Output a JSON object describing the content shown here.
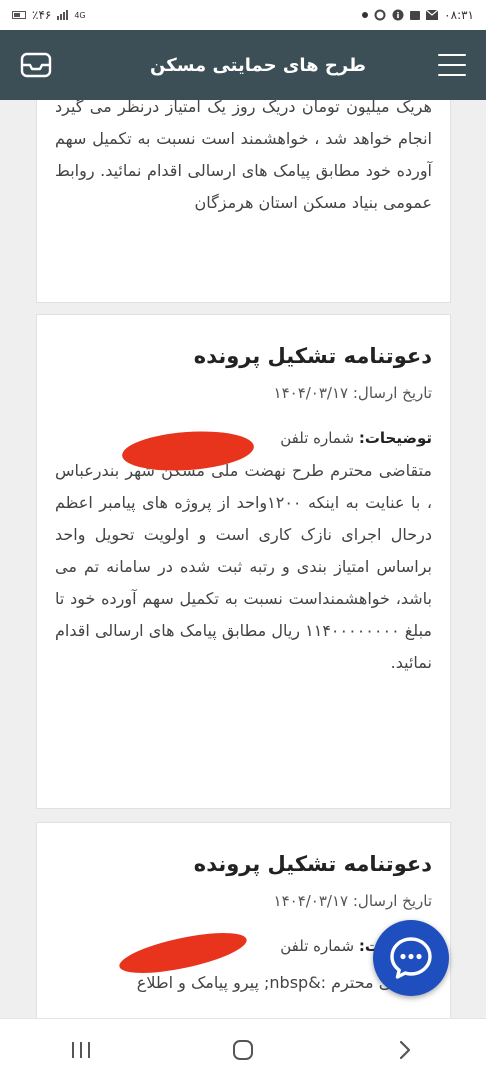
{
  "status_bar": {
    "time": "۰۸:۳۱",
    "battery": "٪۴۶",
    "network": "4G"
  },
  "app_bar": {
    "title": "طرح های حمایتی مسکن",
    "menu_icon": "hamburger-menu-icon",
    "inbox_icon": "inbox-tray-icon"
  },
  "cards": [
    {
      "partial_text": "هریک میلیون تومان دریک روز یک امتیاز درنظر می گیرد انجام خواهد شد ، خواهشمند است نسبت به تکمیل سهم آورده خود مطابق پیامک های ارسالی اقدام نمائید. روابط عمومی بنیاد مسکن استان هرمزگان"
    },
    {
      "title": "دعوتنامه تشکیل پرونده",
      "date_label": "تاریخ ارسال:",
      "date": "۱۴۰۴/۰۳/۱۷",
      "desc_label": "توضیحات:",
      "desc_prefix": "شماره تلفن",
      "body": "متقاضی محترم طرح نهضت ملی مسکن شهر بندرعباس ، با عنایت به اینکه ۱۲۰۰واحد از پروژه های پیامبر اعظم درحال اجرای نازک کاری است و اولویت تحویل واحد براساس امتیاز بندی و رتبه ثبت شده در سامانه تم می باشد، خواهشمنداست نسبت به تکمیل سهم آورده خود تا مبلغ ۱۱۴۰۰۰۰۰۰۰۰ ریال مطابق پیامک های ارسالی اقدام نمائید."
    },
    {
      "title": "دعوتنامه تشکیل پرونده",
      "date_label": "تاریخ ارسال:",
      "date": "۱۴۰۴/۰۳/۱۷",
      "desc_label": "توضیحات:",
      "desc_prefix": "شماره تلفن",
      "body": "متقاضی محترم :&nbsp; پیرو پیامک و اطلاع"
    }
  ],
  "fab": {
    "icon": "chat-bubble-icon"
  },
  "nav_bar": {
    "recents_icon": "recents-icon",
    "home_icon": "home-icon",
    "back_icon": "back-chevron-icon"
  },
  "colors": {
    "app_bar": "#3c4e56",
    "fab": "#1f4fbf",
    "redaction": "#e8341c"
  }
}
